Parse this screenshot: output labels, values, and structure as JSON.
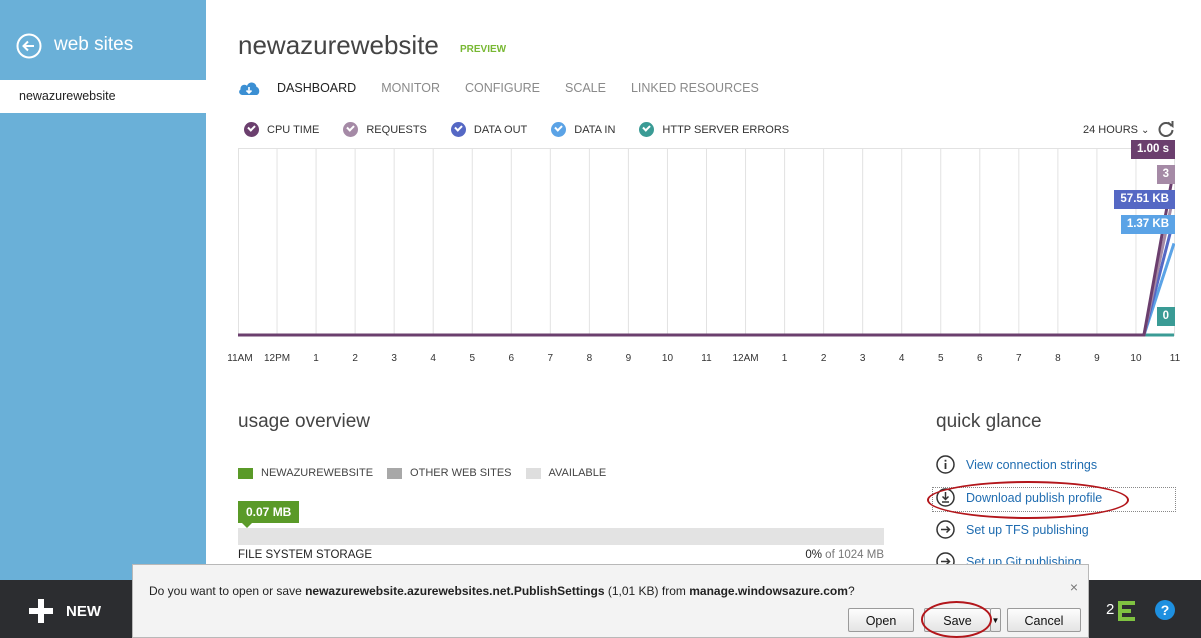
{
  "nav": {
    "back_label": "web sites",
    "site_item": "newazurewebsite"
  },
  "header": {
    "title": "newazurewebsite",
    "badge": "PREVIEW",
    "tabs": [
      "DASHBOARD",
      "MONITOR",
      "CONFIGURE",
      "SCALE",
      "LINKED RESOURCES"
    ],
    "active_tab": "DASHBOARD"
  },
  "metrics": {
    "legend": [
      {
        "label": "CPU TIME",
        "color": "#6b3f6e"
      },
      {
        "label": "REQUESTS",
        "color": "#a58aa6"
      },
      {
        "label": "DATA OUT",
        "color": "#5568c4"
      },
      {
        "label": "DATA IN",
        "color": "#5ba3e6"
      },
      {
        "label": "HTTP SERVER ERRORS",
        "color": "#3a9b95"
      }
    ],
    "time_range": "24 HOURS",
    "refresh_icon": "refresh-icon"
  },
  "chart_data": {
    "type": "line",
    "x": [
      "11AM",
      "12PM",
      "1",
      "2",
      "3",
      "4",
      "5",
      "6",
      "7",
      "8",
      "9",
      "10",
      "11",
      "12AM",
      "1",
      "2",
      "3",
      "4",
      "5",
      "6",
      "7",
      "8",
      "9",
      "10",
      "11"
    ],
    "series": [
      {
        "name": "CPU TIME",
        "color": "#6b3f6e",
        "last_value": "1.00 s",
        "level": 1.0
      },
      {
        "name": "REQUESTS",
        "color": "#a58aa6",
        "last_value": "3",
        "level": 0.84
      },
      {
        "name": "DATA OUT",
        "color": "#5568c4",
        "last_value": "57.51 KB",
        "level": 0.68
      },
      {
        "name": "DATA IN",
        "color": "#5ba3e6",
        "last_value": "1.37 KB",
        "level": 0.52
      },
      {
        "name": "HTTP SERVER ERRORS",
        "color": "#3a9b95",
        "last_value": "0",
        "level": 0.0
      }
    ],
    "grid": true
  },
  "usage": {
    "title": "usage overview",
    "legend": [
      {
        "label": "NEWAZUREWEBSITE",
        "color": "#5a9a28"
      },
      {
        "label": "OTHER WEB SITES",
        "color": "#a8a8a8"
      },
      {
        "label": "AVAILABLE",
        "color": "#dedede"
      }
    ],
    "value": "0.07 MB",
    "fraction": 0.0,
    "caption": "FILE SYSTEM STORAGE",
    "percent": "0%",
    "stat_suffix": " of 1024 MB"
  },
  "quick_glance": {
    "title": "quick glance",
    "items": [
      {
        "label": "View connection strings",
        "icon": "info-icon"
      },
      {
        "label": "Download publish profile",
        "icon": "download-icon"
      },
      {
        "label": "Set up TFS publishing",
        "icon": "arrow-right-icon"
      },
      {
        "label": "Set up Git publishing",
        "icon": "arrow-right-icon"
      }
    ]
  },
  "bottombar": {
    "new_label": "NEW",
    "notification_count": "2"
  },
  "dialog": {
    "msg_prefix": "Do you want to open or save ",
    "filename": "newazurewebsite.azurewebsites.net.PublishSettings",
    "size": " (1,01 KB) from ",
    "source": "manage.windowsazure.com",
    "msg_suffix": "?",
    "buttons": {
      "open": "Open",
      "save": "Save",
      "cancel": "Cancel"
    },
    "close": "×"
  }
}
